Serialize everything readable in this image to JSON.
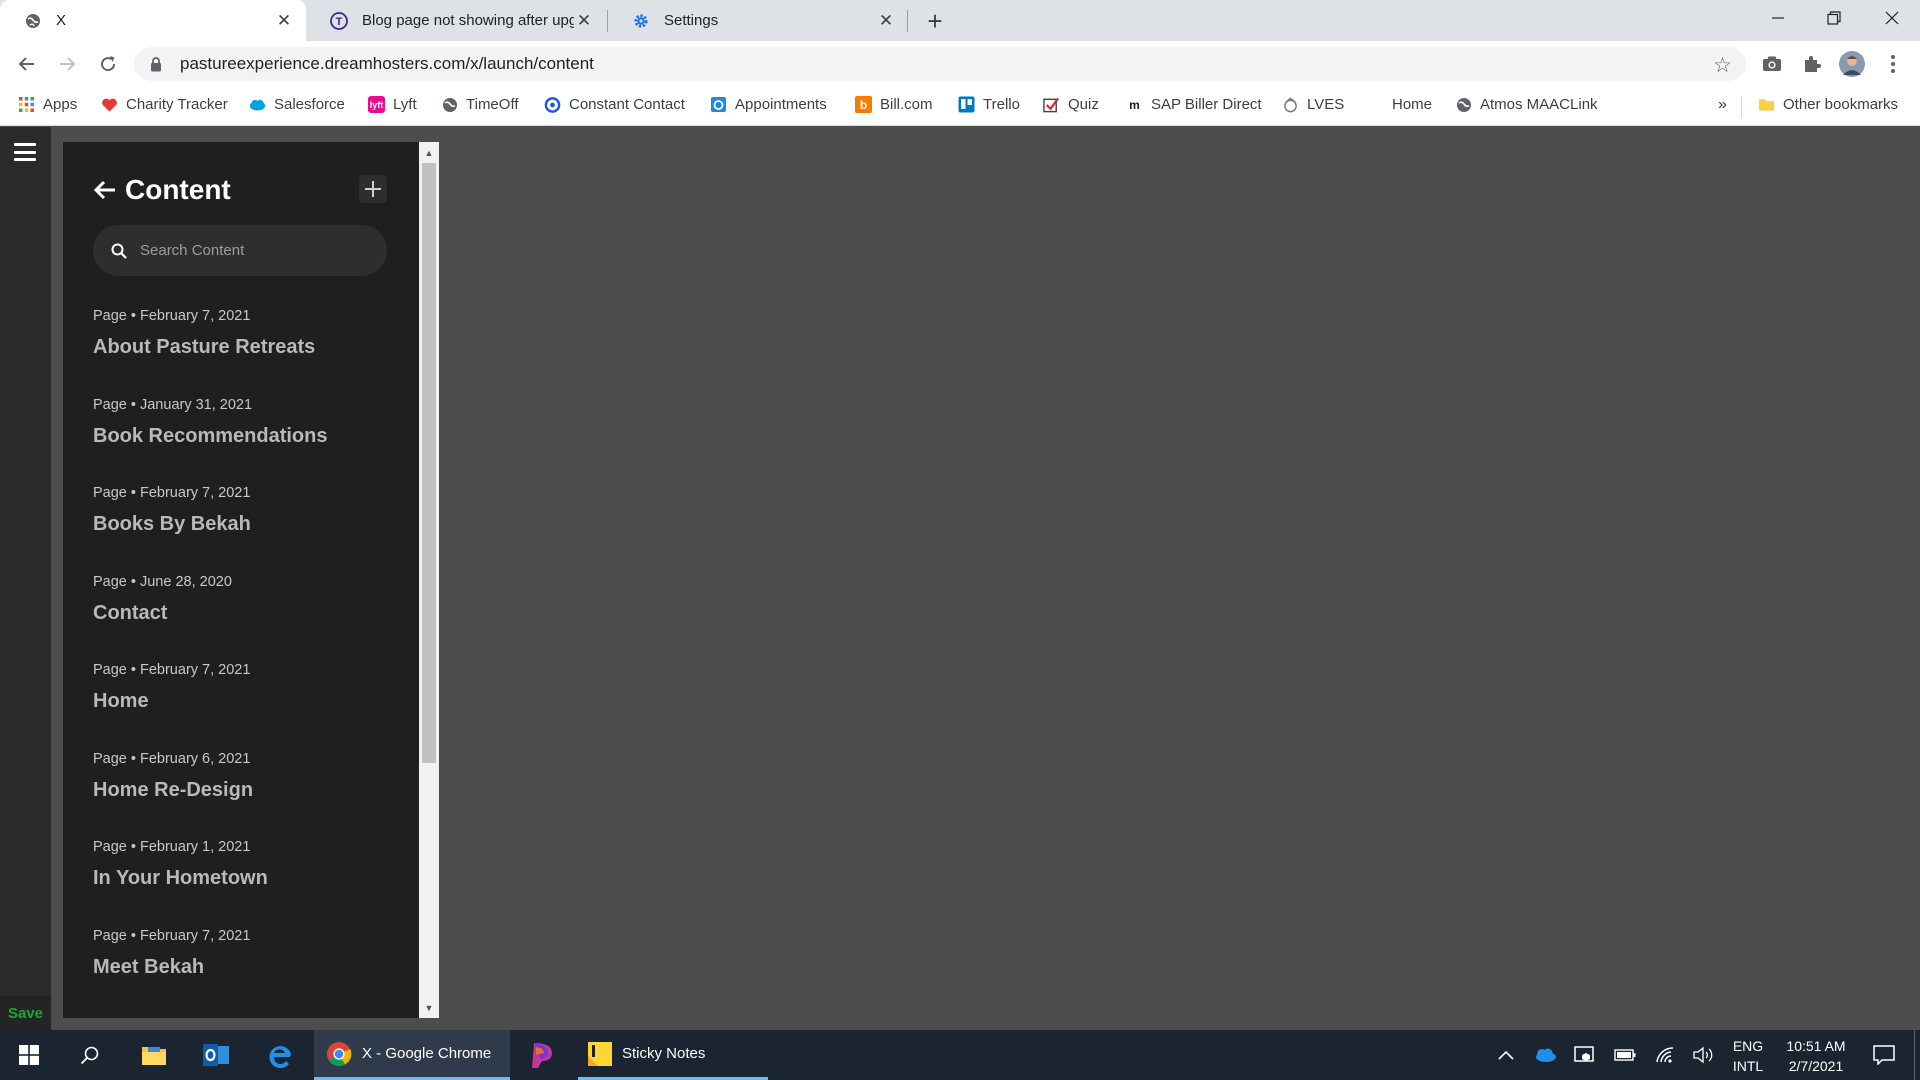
{
  "tabs": [
    {
      "title": "X",
      "icon": "globe-icon",
      "active": true
    },
    {
      "title": "Blog page not showing after upg",
      "icon": "tumblr-t-icon",
      "active": false
    },
    {
      "title": "Settings",
      "icon": "gear-icon",
      "active": false
    }
  ],
  "omnibox": {
    "url": "pastureexperience.dreamhosters.com/x/launch/content"
  },
  "bookmarks": [
    {
      "label": "Apps",
      "icon": "apps-grid-icon"
    },
    {
      "label": "Charity Tracker",
      "icon": "heart-icon"
    },
    {
      "label": "Salesforce",
      "icon": "cloud-icon"
    },
    {
      "label": "Lyft",
      "icon": "lyft-icon"
    },
    {
      "label": "TimeOff",
      "icon": "globe-icon"
    },
    {
      "label": "Constant Contact",
      "icon": "constant-contact-icon"
    },
    {
      "label": "Appointments",
      "icon": "calendar-icon"
    },
    {
      "label": "Bill.com",
      "icon": "bill-icon"
    },
    {
      "label": "Trello",
      "icon": "trello-icon"
    },
    {
      "label": "Quiz",
      "icon": "checkbox-icon"
    },
    {
      "label": "SAP Biller Direct",
      "icon": "sap-icon"
    },
    {
      "label": "LVES",
      "icon": "lves-icon"
    },
    {
      "label": "Home",
      "icon": ""
    },
    {
      "label": "Atmos MAACLink",
      "icon": "globe-icon"
    }
  ],
  "bookmarks_overflow": "»",
  "other_bookmarks": "Other bookmarks",
  "sidebar": {
    "save_label": "Save"
  },
  "panel": {
    "title": "Content",
    "search_placeholder": "Search Content",
    "items": [
      {
        "meta": "Page • February 7, 2021",
        "title": "About Pasture Retreats"
      },
      {
        "meta": "Page • January 31, 2021",
        "title": "Book Recommendations"
      },
      {
        "meta": "Page • February 7, 2021",
        "title": "Books By Bekah"
      },
      {
        "meta": "Page • June 28, 2020",
        "title": "Contact"
      },
      {
        "meta": "Page • February 7, 2021",
        "title": "Home"
      },
      {
        "meta": "Page • February 6, 2021",
        "title": "Home Re-Design"
      },
      {
        "meta": "Page • February 1, 2021",
        "title": "In Your Hometown"
      },
      {
        "meta": "Page • February 7, 2021",
        "title": "Meet Bekah"
      }
    ]
  },
  "taskbar": {
    "chrome_label": "X - Google Chrome",
    "sticky_label": "Sticky Notes",
    "lang1": "ENG",
    "lang2": "INTL",
    "time": "10:51 AM",
    "date": "2/7/2021"
  },
  "colors": {
    "accent_save": "#1fa43b",
    "panel_bg": "#1f1f1f",
    "canvas_bg": "#4d4d4d"
  }
}
